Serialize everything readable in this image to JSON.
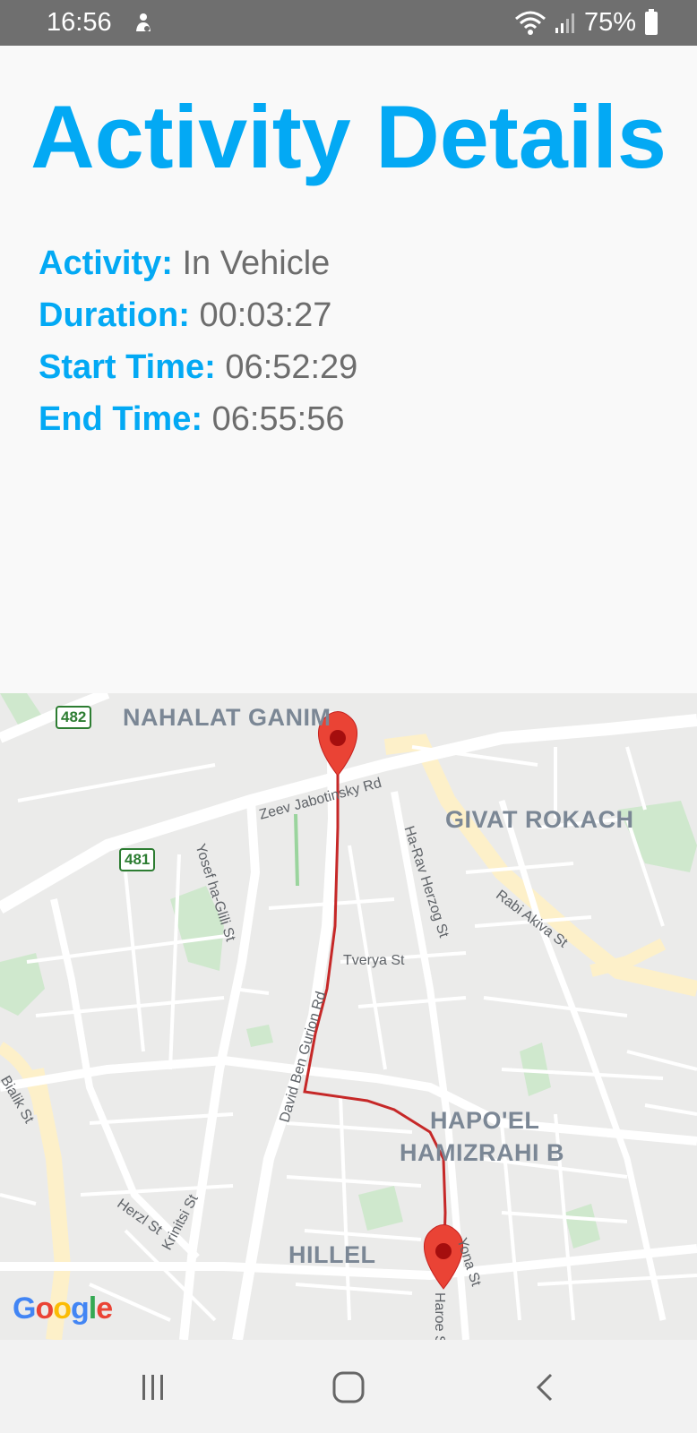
{
  "status_bar": {
    "time": "16:56",
    "battery": "75%"
  },
  "page": {
    "title": "Activity Details"
  },
  "details": [
    {
      "label": "Activity:",
      "value": "In Vehicle"
    },
    {
      "label": "Duration:",
      "value": "00:03:27"
    },
    {
      "label": "Start Time:",
      "value": "06:52:29"
    },
    {
      "label": "End Time:",
      "value": "06:55:56"
    }
  ],
  "map": {
    "neighborhoods": {
      "nahalat_ganim": "NAHALAT GANIM",
      "givat_rokach": "GIVAT ROKACH",
      "hapoel_line1": "HAPO'EL",
      "hapoel_line2": "HAMIZRAHI B",
      "hillel": "HILLEL"
    },
    "streets": {
      "zeev": "Zeev Jabotinsky Rd",
      "herzog": "Ha-Rav Herzog St",
      "rabi_akiva": "Rabi Akiva St",
      "yosef": "Yosef ha-Glili St",
      "tverya": "Tverya St",
      "ben_gurion": "David Ben Gurion Rd",
      "bialik": "Bialik St",
      "herzl": "Herzl St",
      "krinitsi": "Krinitsi St",
      "yona": "Yona St",
      "haroe": "Haroe St"
    },
    "shields": {
      "r482": "482",
      "r481": "481"
    },
    "attribution": "Google",
    "route_color": "#c62828",
    "marker_color": "#ea4335"
  },
  "colors": {
    "accent": "#03a9f4",
    "value_text": "#6d6d6d"
  }
}
